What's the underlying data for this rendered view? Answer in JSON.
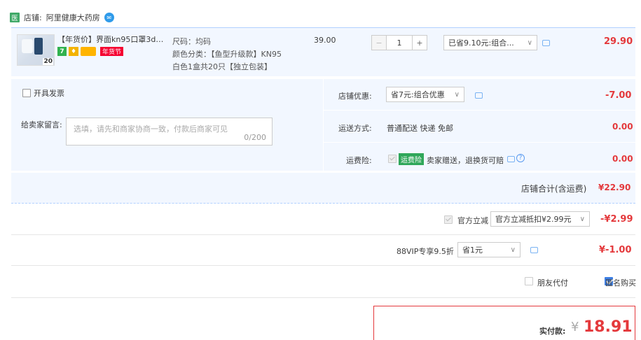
{
  "store": {
    "icon_text": "医",
    "label": "店铺:",
    "name": "阿里健康大药房"
  },
  "item": {
    "title": "【年货价】界面kn95口罩3d立...",
    "thumb_count": "20",
    "badge_seven": "7",
    "badge_fest": "年货节",
    "sku_size": "尺码：均码",
    "sku_color": "颜色分类：【鱼型升级款】KN95",
    "sku_color2": "白色1盒共20只【独立包装】",
    "unit_price": "39.00",
    "quantity": "1",
    "promo_select": "已省9.10元:组合...",
    "line_total": "29.90"
  },
  "order": {
    "invoice_label": "开具发票",
    "message_label": "给卖家留言:",
    "message_placeholder": "选填，请先和商家协商一致，付款后商家可见",
    "message_count": "0/200",
    "shop_discount_label": "店铺优惠:",
    "shop_discount_select": "省7元:组合优惠",
    "shop_discount_value": "-7.00",
    "shipping_label": "运送方式:",
    "shipping_value": "普通配送 快递 免邮",
    "shipping_fee": "0.00",
    "insurance_label": "运费险:",
    "insurance_tag": "运费险",
    "insurance_desc": "卖家赠送，退换货可赔",
    "insurance_fee": "0.00",
    "shop_total_label": "店铺合计(含运费)",
    "shop_total_value": "¥22.90"
  },
  "discounts": {
    "official_label": "官方立减",
    "official_select": "官方立减抵扣¥2.99元",
    "official_value": "-¥2.99",
    "vip_label": "88VIP专享9.5折",
    "vip_select": "省1元",
    "vip_value": "¥-1.00",
    "friend_pay_label": "朋友代付",
    "anonymous_label": "匿名购买"
  },
  "payment": {
    "label": "实付款:",
    "currency": "¥",
    "amount": "18.91"
  },
  "colors": {
    "accent_red": "#e4393c",
    "panel_blue": "#f2f7ff",
    "checkbox_blue": "#3e80e5"
  }
}
